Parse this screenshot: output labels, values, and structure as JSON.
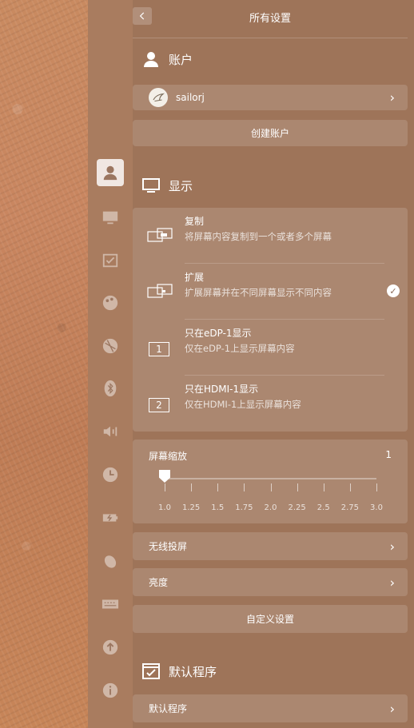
{
  "header": {
    "title": "所有设置"
  },
  "account": {
    "section_title": "账户",
    "user_name": "sailorj",
    "create_label": "创建账户"
  },
  "display": {
    "section_title": "显示",
    "modes": [
      {
        "title": "复制",
        "desc": "将屏幕内容复制到一个或者多个屏幕",
        "selected": false
      },
      {
        "title": "扩展",
        "desc": "扩展屏幕并在不同屏幕显示不同内容",
        "selected": true
      },
      {
        "title": "只在eDP-1显示",
        "desc": "仅在eDP-1上显示屏幕内容",
        "badge": "1",
        "selected": false
      },
      {
        "title": "只在HDMI-1显示",
        "desc": "仅在HDMI-1上显示屏幕内容",
        "badge": "2",
        "selected": false
      }
    ],
    "scale": {
      "title": "屏幕缩放",
      "value": "1",
      "ticks": [
        "1.0",
        "1.25",
        "1.5",
        "1.75",
        "2.0",
        "2.25",
        "2.5",
        "2.75",
        "3.0"
      ]
    },
    "wireless_label": "无线投屏",
    "brightness_label": "亮度",
    "custom_label": "自定义设置"
  },
  "default_apps": {
    "section_title": "默认程序",
    "row_label": "默认程序"
  },
  "sidebar_icons": [
    "account-icon",
    "display-icon",
    "default-apps-icon",
    "personalization-icon",
    "network-icon",
    "bluetooth-icon",
    "sound-icon",
    "datetime-icon",
    "power-icon",
    "mouse-icon",
    "keyboard-icon",
    "update-icon",
    "info-icon"
  ]
}
